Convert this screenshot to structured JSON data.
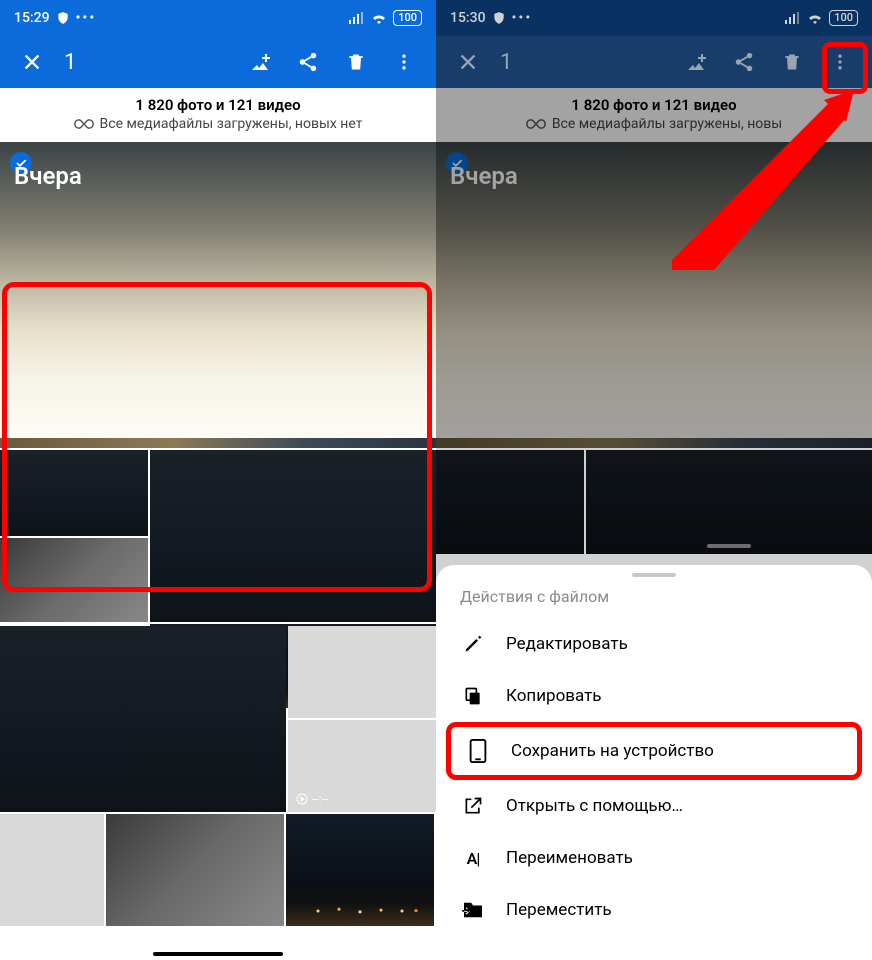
{
  "left": {
    "status_time": "15:29",
    "toolbar": {
      "count": "1"
    },
    "info": {
      "count_line": "1 820 фото и 121 видео",
      "sync_line": "Все медиафайлы загружены, новых нет"
    },
    "hero_label": "Вчера",
    "video_time": "--:--"
  },
  "right": {
    "status_time": "15:30",
    "toolbar": {
      "count": "1"
    },
    "info": {
      "count_line": "1 820 фото и 121 видео",
      "sync_line": "Все медиафайлы загружены, новы"
    },
    "hero_label": "Вчера",
    "sheet": {
      "title": "Действия с файлом",
      "edit": "Редактировать",
      "copy": "Копировать",
      "save": "Сохранить на устройство",
      "open_with": "Открыть с помощью…",
      "rename": "Переименовать",
      "move": "Переместить"
    }
  },
  "battery": "100"
}
